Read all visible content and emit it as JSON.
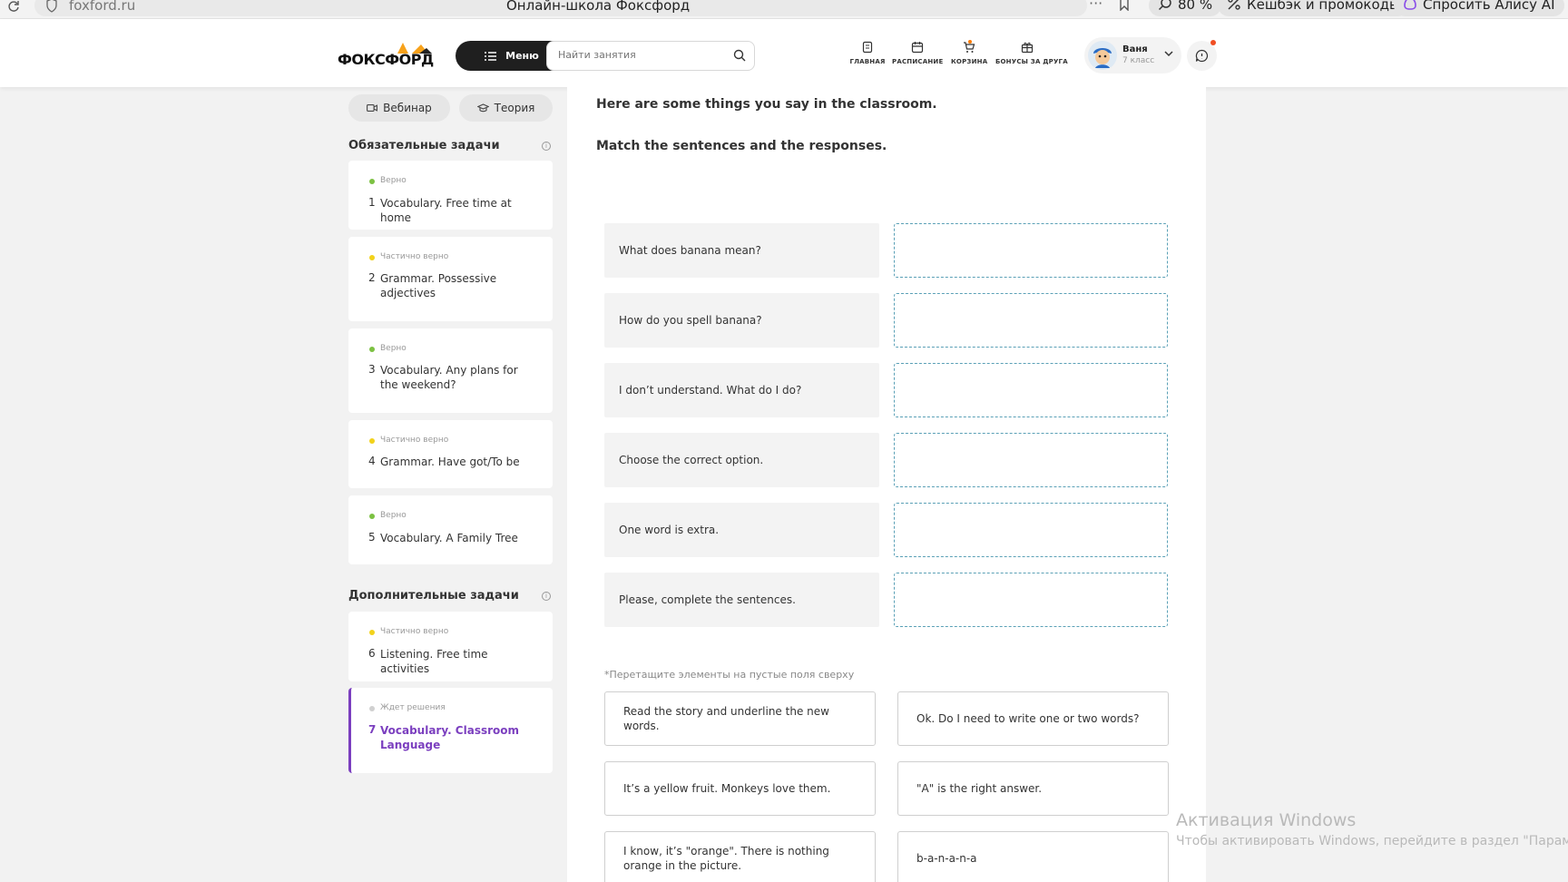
{
  "browser": {
    "url": "foxford.ru",
    "title": "Онлайн-школа Фоксфорд",
    "zoom": "80 %",
    "cashback": "Кешбэк и промокоды",
    "alice": "Спросить Алису AI"
  },
  "header": {
    "logo": "ФОКСФОРД",
    "menu_label": "Меню",
    "search_placeholder": "Найти занятия",
    "nav": [
      {
        "label": "ГЛАВНАЯ",
        "icon": "home-icon"
      },
      {
        "label": "РАСПИСАНИЕ",
        "icon": "calendar-icon"
      },
      {
        "label": "КОРЗИНА",
        "icon": "cart-icon"
      },
      {
        "label": "БОНУСЫ ЗА ДРУГА",
        "icon": "gift-icon"
      }
    ],
    "user": {
      "name": "Ваня",
      "grade": "7 класс"
    }
  },
  "sidebar": {
    "tabs": [
      {
        "label": "Вебинар",
        "icon": "video-icon"
      },
      {
        "label": "Теория",
        "icon": "graduation-cap-icon"
      }
    ],
    "required_title": "Обязательные задачи",
    "extra_title": "Дополнительные задачи",
    "tasks": [
      {
        "num": "1",
        "status": "Верно",
        "title": "Vocabulary. Free time at home",
        "status_color": "#7cc142"
      },
      {
        "num": "2",
        "status": "Частично верно",
        "title": "Grammar. Possessive adjectives",
        "status_color": "#f2d21b"
      },
      {
        "num": "3",
        "status": "Верно",
        "title": "Vocabulary. Any plans for the weekend?",
        "status_color": "#7cc142"
      },
      {
        "num": "4",
        "status": "Частично верно",
        "title": "Grammar. Have got/To be",
        "status_color": "#f2d21b"
      },
      {
        "num": "5",
        "status": "Верно",
        "title": "Vocabulary. A Family Tree",
        "status_color": "#7cc142"
      },
      {
        "num": "6",
        "status": "Частично верно",
        "title": "Listening. Free time activities",
        "status_color": "#f2d21b"
      },
      {
        "num": "7",
        "status": "Ждет решения",
        "title": "Vocabulary. Classroom Language",
        "status_color": "#d0d0d0"
      }
    ]
  },
  "main": {
    "instruction1": "Here are some things you say in the classroom.",
    "instruction2": "Match the sentences and the responses.",
    "prompts": [
      "What does banana mean?",
      "How do you spell banana?",
      "I don’t understand. What do I do?",
      "Choose the correct option.",
      "One word is extra.",
      "Please, complete the sentences."
    ],
    "hint": "*Перетащите элементы на пустые поля сверху",
    "options": [
      "Read the story and underline the new words.",
      "Ok. Do I need to write one or two words?",
      "It’s a yellow fruit. Monkeys love them.",
      "\"A\" is the right answer.",
      "I know, it’s \"orange\". There is nothing orange in the picture.",
      "b-a-n-a-n-a"
    ]
  },
  "watermark": {
    "line1": "Активация Windows",
    "line2": "Чтобы активировать Windows, перейдите в раздел \"Параметры\""
  }
}
